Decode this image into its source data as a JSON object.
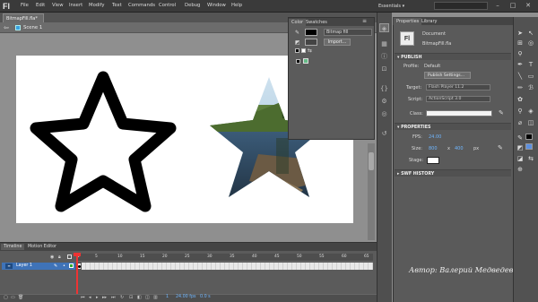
{
  "app": {
    "logo": "Fl",
    "menu": [
      "File",
      "Edit",
      "View",
      "Insert",
      "Modify",
      "Text",
      "Commands",
      "Control",
      "Debug",
      "Window",
      "Help"
    ],
    "workspace": "Essentials ▾"
  },
  "document": {
    "tab": "BitmapFill.fla*",
    "scene": "Scene 1"
  },
  "color_panel": {
    "tabs": [
      "Color",
      "Swatches"
    ],
    "fill_type": "Bitmap fill",
    "import_label": "Import..."
  },
  "properties": {
    "tabs": [
      "Properties",
      "Library"
    ],
    "doc_icon": "Fl",
    "doc_type": "Document",
    "doc_name": "BitmapFill.fla",
    "publish": {
      "header": "PUBLISH",
      "profile_label": "Profile:",
      "profile": "Default",
      "settings_btn": "Publish Settings...",
      "target_label": "Target:",
      "target": "Flash Player 11.2",
      "script_label": "Script:",
      "script": "ActionScript 3.0",
      "class_label": "Class:",
      "class": ""
    },
    "props": {
      "header": "PROPERTIES",
      "fps_label": "FPS:",
      "fps": "24.00",
      "size_label": "Size:",
      "width": "800",
      "x": "x",
      "height": "400",
      "unit": "px",
      "stage_label": "Stage:",
      "stage_color": "#ffffff"
    },
    "history_header": "SWF HISTORY"
  },
  "timeline": {
    "tabs": [
      "Timeline",
      "Motion Editor"
    ],
    "layer": "Layer 1",
    "ticks": [
      "1",
      "5",
      "10",
      "15",
      "20",
      "25",
      "30",
      "35",
      "40",
      "45",
      "50",
      "55",
      "60",
      "65"
    ],
    "fps": "24.00 fps",
    "time": "0.0 s",
    "frame": "1"
  },
  "watermark": "Автор: Валерий Медведев",
  "colors": {
    "menubar": "#3a3a3a",
    "panel": "#5a5a5a",
    "stage": "#ffffff",
    "accent": "#6fb6ff",
    "layer_selected": "#3f73b8",
    "playhead": "#e33333"
  }
}
